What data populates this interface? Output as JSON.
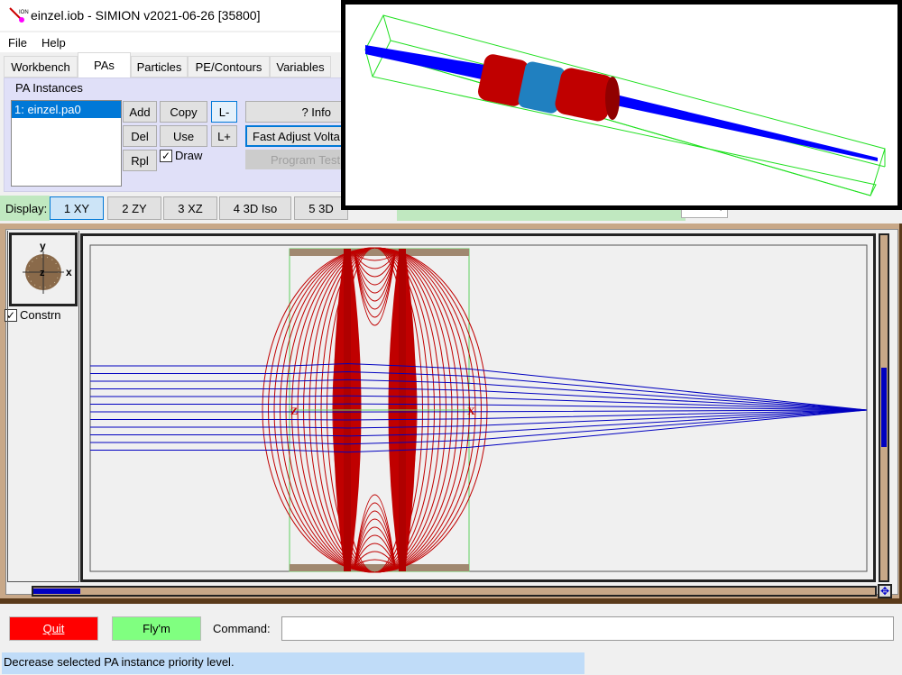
{
  "window": {
    "title": "einzel.iob - SIMION v2021-06-26 [35800]",
    "app_icon": "simion-ion-icon"
  },
  "menu": [
    {
      "label": "File"
    },
    {
      "label": "Help"
    }
  ],
  "tabs": [
    {
      "label": "Workbench"
    },
    {
      "label": "PAs",
      "active": true
    },
    {
      "label": "Particles"
    },
    {
      "label": "PE/Contours"
    },
    {
      "label": "Variables"
    }
  ],
  "pa_panel": {
    "group_label": "PA Instances",
    "instances": [
      {
        "label": "1: einzel.pa0",
        "selected": true
      }
    ],
    "buttons": {
      "add": "Add",
      "copy": "Copy",
      "l_minus": "L-",
      "del": "Del",
      "use": "Use",
      "l_plus": "L+",
      "rpl": "Rpl",
      "info": "? Info",
      "fast_adjust": "Fast Adjust Volta",
      "program_test": "Program Test"
    },
    "draw_checkbox": {
      "label": "Draw",
      "checked": true
    }
  },
  "display_bar": {
    "label": "Display:",
    "buttons": [
      {
        "label": "1 XY",
        "active": true
      },
      {
        "label": "2 ZY"
      },
      {
        "label": "3 XZ"
      },
      {
        "label": "4 3D Iso"
      },
      {
        "label": "5 3D"
      }
    ]
  },
  "view": {
    "constrain": {
      "label": "Constrn",
      "checked": true
    },
    "axis_labels": {
      "y": "y",
      "x": "x",
      "z": "z"
    },
    "center_labels": {
      "left": "Z",
      "right": "X"
    }
  },
  "colors": {
    "contour": "#c00000",
    "trajectory": "#0000c0",
    "frame": "#c8a888",
    "quit": "#ff0000",
    "flym": "#80ff80",
    "status": "#c0dcf8"
  },
  "bottom": {
    "quit": "Quit",
    "flym": "Fly'm",
    "command_label": "Command:",
    "command_value": ""
  },
  "status": {
    "text": "Decrease selected PA instance priority level."
  }
}
